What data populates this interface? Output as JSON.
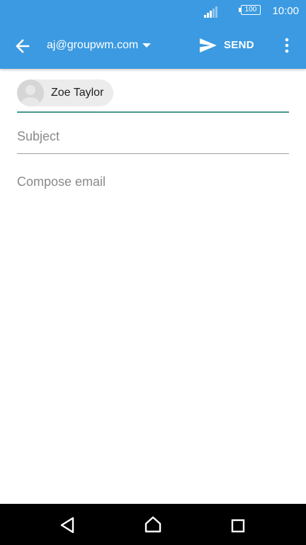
{
  "status_bar": {
    "battery_level": "100",
    "time": "10:00",
    "icons": [
      "signal-icon",
      "battery-icon"
    ]
  },
  "app_bar": {
    "account": "aj@groupwm.com",
    "send_label": "SEND",
    "icons": [
      "back-arrow-icon",
      "dropdown-arrow-icon",
      "send-icon",
      "overflow-menu-icon"
    ]
  },
  "compose": {
    "recipient_name": "Zoe Taylor",
    "subject_placeholder": "Subject",
    "body_placeholder": "Compose email"
  },
  "nav_bar": {
    "icons": [
      "nav-back-icon",
      "nav-home-icon",
      "nav-recents-icon"
    ]
  },
  "colors": {
    "primary": "#3b9ae1",
    "to_field_underline": "#47978d",
    "placeholder_text": "#8a8a8a",
    "chip_background": "#ececec"
  }
}
